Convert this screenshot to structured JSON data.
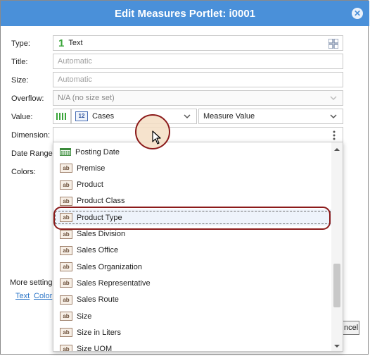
{
  "dialog": {
    "title": "Edit Measures Portlet: i0001",
    "close_glyph": "✕"
  },
  "form": {
    "type_label": "Type:",
    "type_number": "1",
    "type_value": "Text",
    "title_label": "Title:",
    "title_placeholder": "Automatic",
    "size_label": "Size:",
    "size_placeholder": "Automatic",
    "overflow_label": "Overflow:",
    "overflow_value": "N/A (no size set)",
    "value_label": "Value:",
    "value_numeric_badge": "12",
    "value_field": "Cases",
    "value_aggregate": "Measure Value",
    "dimension_label": "Dimension:",
    "date_range_label": "Date Range:",
    "colors_label": "Colors:",
    "more_settings": "More setting",
    "link_text": "Text",
    "link_colors": "Color",
    "cancel_partial": "ncel"
  },
  "dimension_options": [
    {
      "label": "Posting Date",
      "icon": "calendar-icon"
    },
    {
      "label": "Premise",
      "icon": "text-type-icon"
    },
    {
      "label": "Product",
      "icon": "text-type-icon"
    },
    {
      "label": "Product Class",
      "icon": "text-type-icon"
    },
    {
      "label": "Product Type",
      "icon": "text-type-icon"
    },
    {
      "label": "Sales Division",
      "icon": "text-type-icon"
    },
    {
      "label": "Sales Office",
      "icon": "text-type-icon"
    },
    {
      "label": "Sales Organization",
      "icon": "text-type-icon"
    },
    {
      "label": "Sales Representative",
      "icon": "text-type-icon"
    },
    {
      "label": "Sales Route",
      "icon": "text-type-icon"
    },
    {
      "label": "Size",
      "icon": "text-type-icon"
    },
    {
      "label": "Size in Liters",
      "icon": "text-type-icon"
    },
    {
      "label": "Size UOM",
      "icon": "text-type-icon"
    }
  ],
  "highlighted_option": "Product Type",
  "ab_glyph": "ab",
  "colors": {
    "titlebar": "#4a90d9",
    "highlight_ring": "#8b1a1a",
    "link": "#2a74c7"
  }
}
